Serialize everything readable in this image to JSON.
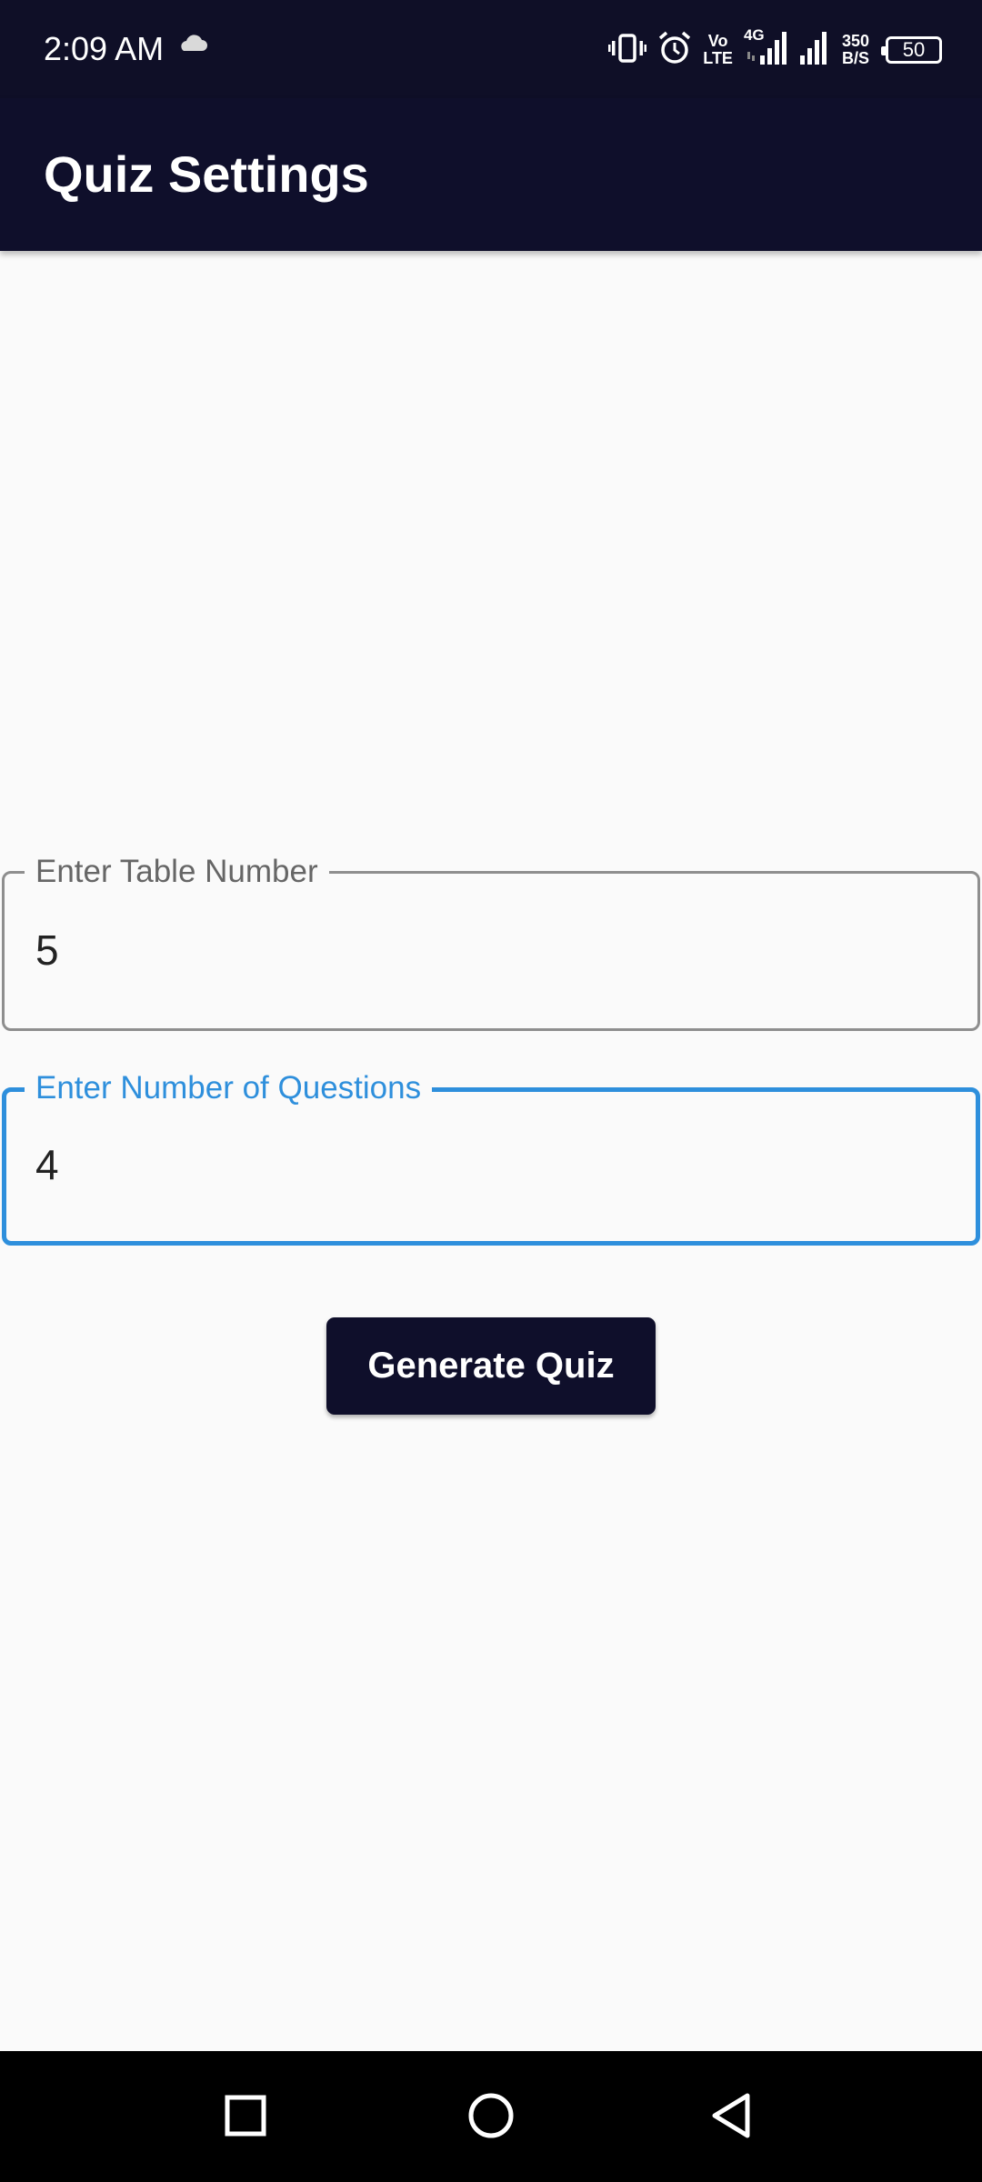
{
  "status_bar": {
    "time": "2:09 AM",
    "volte_top": "Vo",
    "volte_bottom": "LTE",
    "network_type": "4G",
    "net_speed_value": "350",
    "net_speed_unit": "B/S",
    "battery_level": "50"
  },
  "app_bar": {
    "title": "Quiz Settings"
  },
  "form": {
    "table_number": {
      "label": "Enter Table Number",
      "value": "5"
    },
    "question_count": {
      "label": "Enter Number of Questions",
      "value": "4"
    },
    "generate_label": "Generate Quiz"
  },
  "colors": {
    "app_bar": "#0f0f2b",
    "focus_accent": "#2e8fdc",
    "background": "#fafafa"
  },
  "icons": {
    "status": [
      "cloud-icon",
      "vibrate-icon",
      "alarm-icon",
      "signal-icon",
      "signal-icon-2",
      "battery-icon"
    ],
    "nav": [
      "recents-icon",
      "home-icon",
      "back-icon"
    ]
  }
}
